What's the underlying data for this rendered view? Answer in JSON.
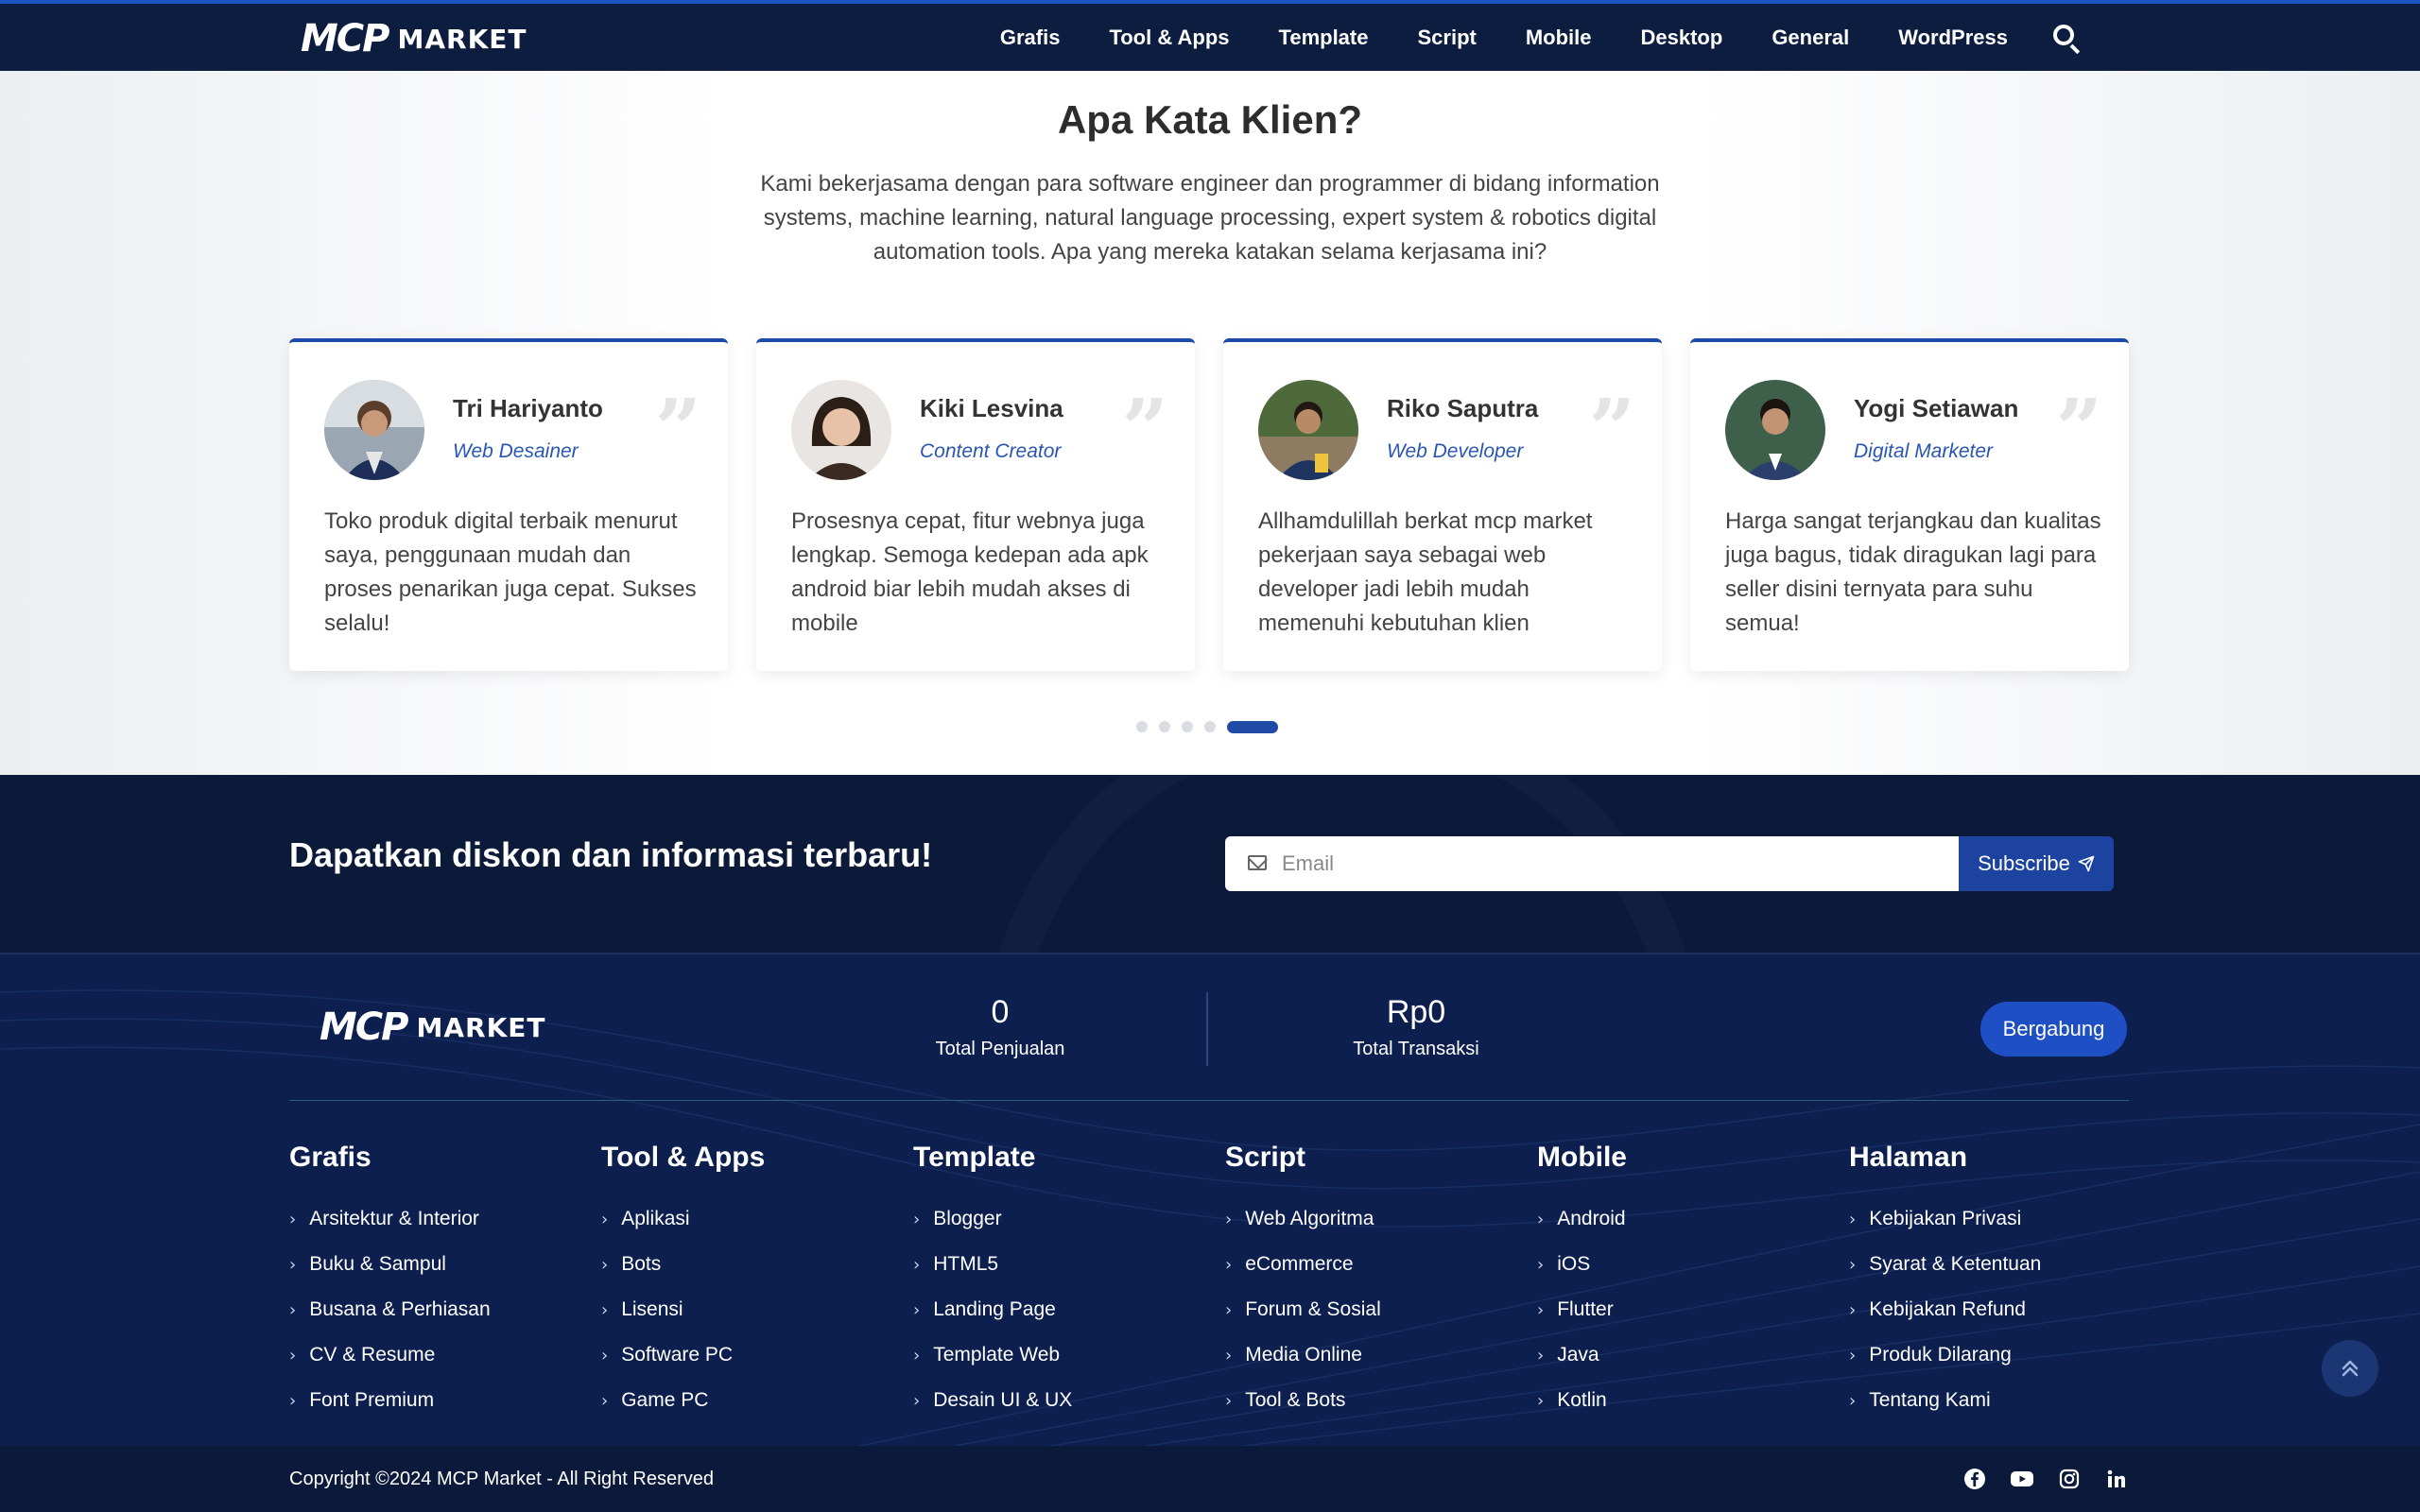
{
  "brand": {
    "logo_mark": "MCP",
    "logo_text": "MARKET"
  },
  "nav": {
    "items": [
      "Grafis",
      "Tool & Apps",
      "Template",
      "Script",
      "Mobile",
      "Desktop",
      "General",
      "WordPress"
    ]
  },
  "testimonials": {
    "title": "Apa Kata Klien?",
    "description": "Kami bekerjasama dengan para software engineer dan programmer di bidang information systems, machine learning, natural language processing, expert system & robotics digital automation tools. Apa yang mereka katakan selama kerjasama ini?",
    "quote_glyph": "”",
    "cards": [
      {
        "name": "Tri Hariyanto",
        "role": "Web Desainer",
        "text": "Toko produk digital terbaik menurut saya, penggunaan mudah dan proses penarikan juga cepat. Sukses selalu!"
      },
      {
        "name": "Kiki Lesvina",
        "role": "Content Creator",
        "text": "Prosesnya cepat, fitur webnya juga lengkap. Semoga kedepan ada apk android biar lebih mudah akses di mobile"
      },
      {
        "name": "Riko Saputra",
        "role": "Web Developer",
        "text": "Allhamdulillah berkat mcp market pekerjaan saya sebagai web developer jadi lebih mudah memenuhi kebutuhan klien"
      },
      {
        "name": "Yogi Setiawan",
        "role": "Digital Marketer",
        "text": "Harga sangat terjangkau dan kualitas juga bagus, tidak diragukan lagi para seller disini ternyata para suhu semua!"
      }
    ],
    "carousel": {
      "total_pages": 5,
      "active_page": 5
    }
  },
  "newsletter": {
    "title": "Dapatkan diskon dan informasi terbaru!",
    "email_placeholder": "Email",
    "subscribe_label": "Subscribe"
  },
  "footer": {
    "stats": [
      {
        "value": "0",
        "label": "Total Penjualan"
      },
      {
        "value": "Rp0",
        "label": "Total Transaksi"
      }
    ],
    "join_label": "Bergabung",
    "columns": [
      {
        "title": "Grafis",
        "links": [
          "Arsitektur & Interior",
          "Buku & Sampul",
          "Busana & Perhiasan",
          "CV & Resume",
          "Font Premium"
        ]
      },
      {
        "title": "Tool & Apps",
        "links": [
          "Aplikasi",
          "Bots",
          "Lisensi",
          "Software PC",
          "Game PC"
        ]
      },
      {
        "title": "Template",
        "links": [
          "Blogger",
          "HTML5",
          "Landing Page",
          "Template Web",
          "Desain UI & UX"
        ]
      },
      {
        "title": "Script",
        "links": [
          "Web Algoritma",
          "eCommerce",
          "Forum & Sosial",
          "Media Online",
          "Tool & Bots"
        ]
      },
      {
        "title": "Mobile",
        "links": [
          "Android",
          "iOS",
          "Flutter",
          "Java",
          "Kotlin"
        ]
      },
      {
        "title": "Halaman",
        "links": [
          "Kebijakan Privasi",
          "Syarat & Ketentuan",
          "Kebijakan Refund",
          "Produk Dilarang",
          "Tentang Kami"
        ]
      }
    ],
    "copyright": "Copyright ©2024 MCP Market - All Right Reserved",
    "socials": [
      "facebook-icon",
      "youtube-icon",
      "instagram-icon",
      "linkedin-icon"
    ]
  },
  "colors": {
    "navy": "#0c1d40",
    "footer_bg": "#0c1f4e",
    "accent_blue": "#1d43a0",
    "role_blue": "#2956b2",
    "button_blue": "#1f4fc4"
  }
}
